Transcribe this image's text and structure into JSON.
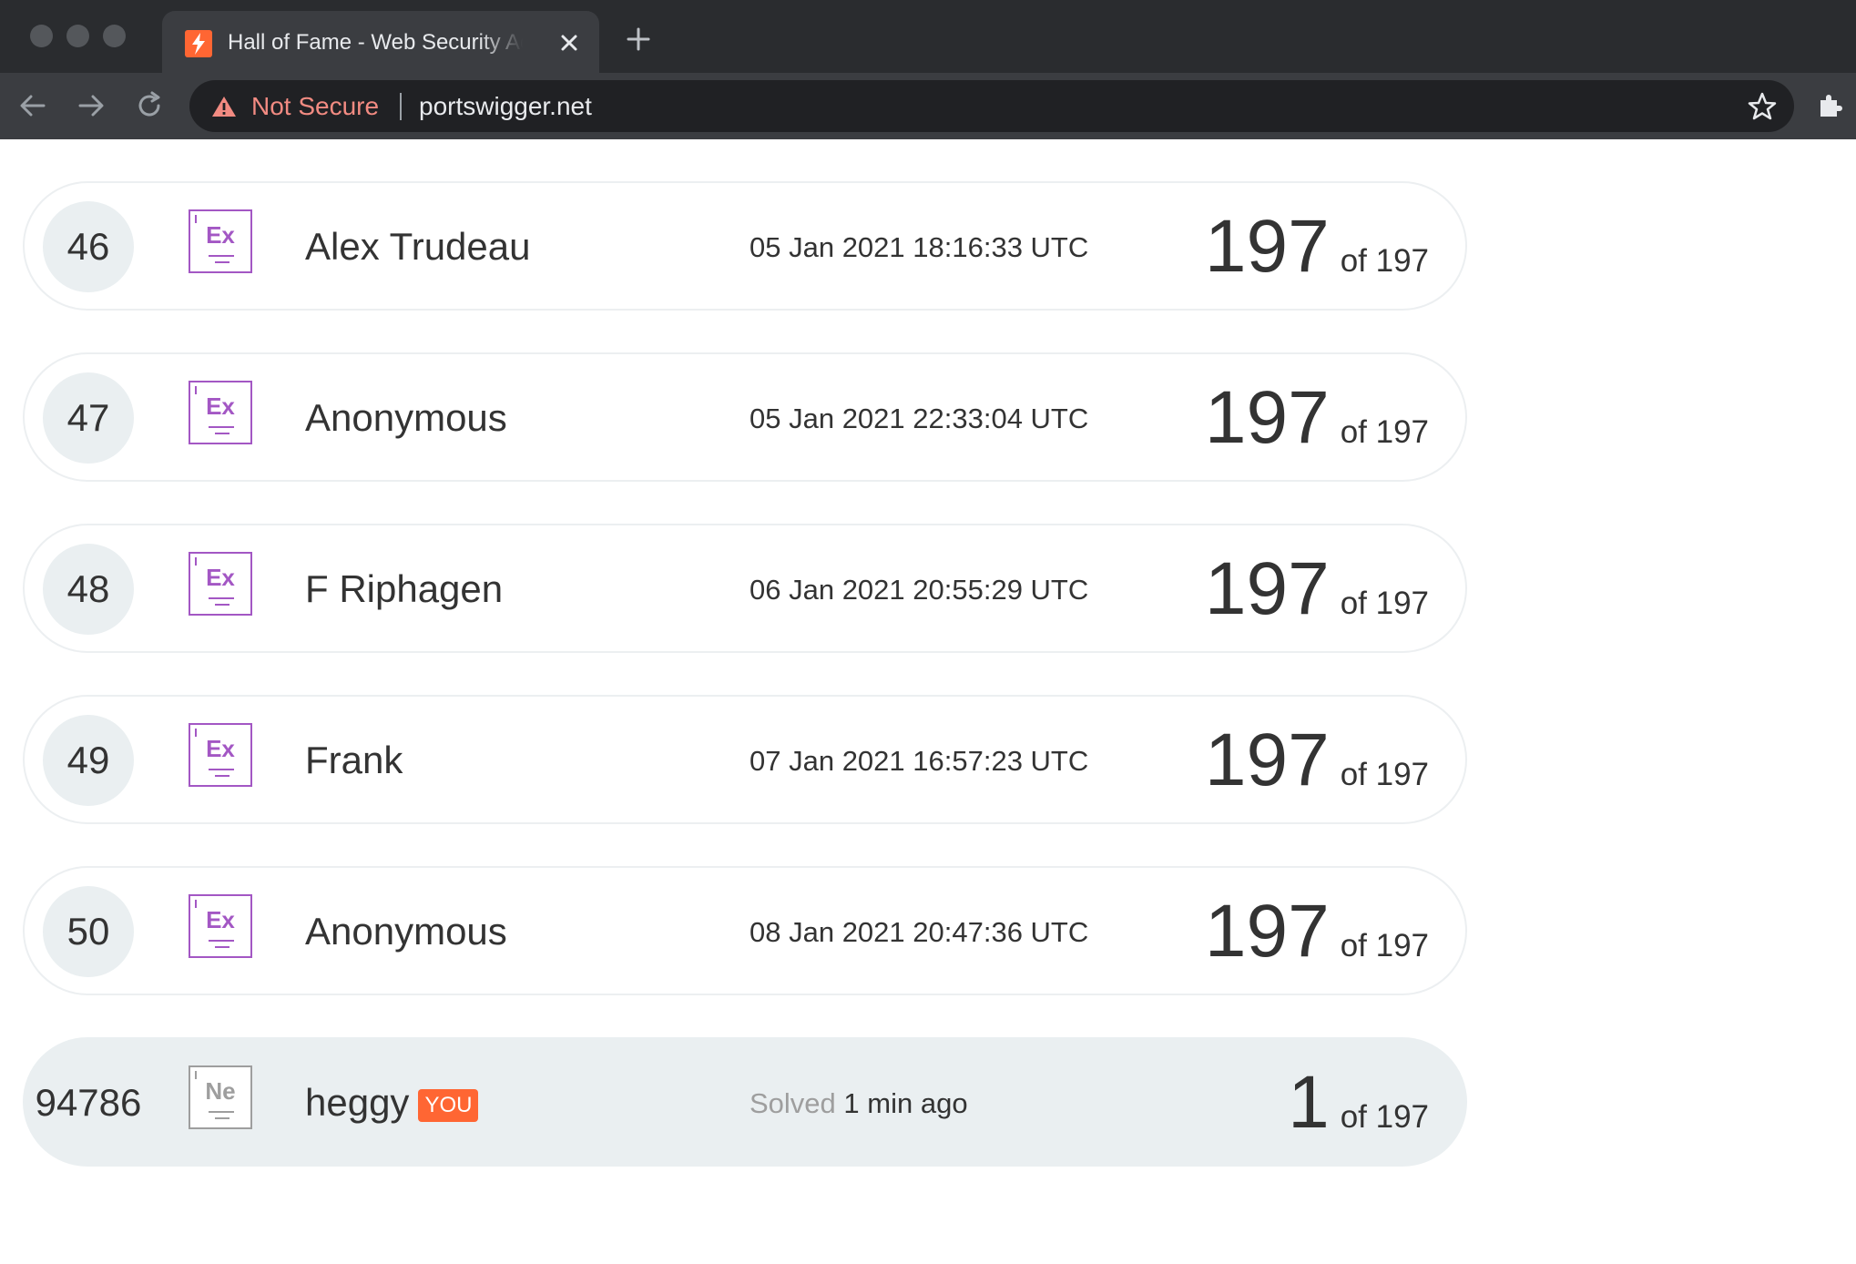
{
  "browser": {
    "tab_title": "Hall of Fame - Web Security Academy",
    "security_label": "Not Secure",
    "url": "portswigger.net"
  },
  "colors": {
    "expert_badge": "#a357c4",
    "novice_badge": "#9e9e9e",
    "you_tag": "#ff6633",
    "highlight_row": "#eaeff1",
    "not_secure": "#f28b82"
  },
  "leaderboard": {
    "rows": [
      {
        "rank": "46",
        "badge": "Ex",
        "name": "Alex Trudeau",
        "date": "05 Jan 2021 18:16:33 UTC",
        "score": "197",
        "of_total": "of 197"
      },
      {
        "rank": "47",
        "badge": "Ex",
        "name": "Anonymous",
        "date": "05 Jan 2021 22:33:04 UTC",
        "score": "197",
        "of_total": "of 197"
      },
      {
        "rank": "48",
        "badge": "Ex",
        "name": "F Riphagen",
        "date": "06 Jan 2021 20:55:29 UTC",
        "score": "197",
        "of_total": "of 197"
      },
      {
        "rank": "49",
        "badge": "Ex",
        "name": "Frank",
        "date": "07 Jan 2021 16:57:23 UTC",
        "score": "197",
        "of_total": "of 197"
      },
      {
        "rank": "50",
        "badge": "Ex",
        "name": "Anonymous",
        "date": "08 Jan 2021 20:47:36 UTC",
        "score": "197",
        "of_total": "of 197"
      }
    ],
    "current_user": {
      "rank": "94786",
      "badge": "Ne",
      "name": "heggy",
      "you_label": "YOU",
      "solved_label": "Solved",
      "solved_time": "1 min ago",
      "score": "1",
      "of_total": "of 197"
    }
  }
}
